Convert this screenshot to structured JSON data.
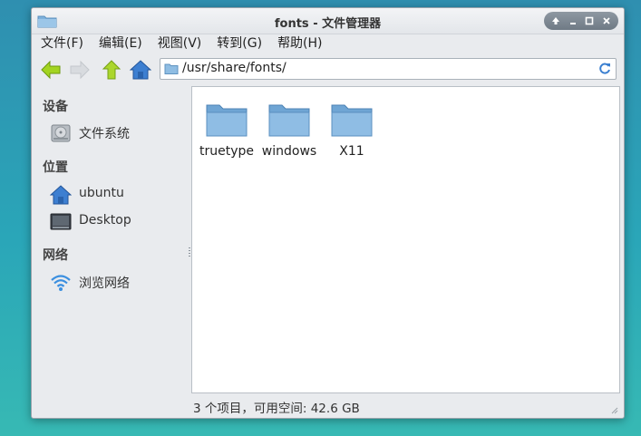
{
  "window": {
    "title": "fonts - 文件管理器"
  },
  "menu": [
    "文件(F)",
    "编辑(E)",
    "视图(V)",
    "转到(G)",
    "帮助(H)"
  ],
  "location": {
    "path": "/usr/share/fonts/"
  },
  "sidebar": {
    "sections": [
      {
        "header": "设备",
        "items": [
          {
            "label": "文件系统",
            "icon": "harddisk-icon"
          }
        ]
      },
      {
        "header": "位置",
        "items": [
          {
            "label": "ubuntu",
            "icon": "home-icon"
          },
          {
            "label": "Desktop",
            "icon": "desktop-icon"
          }
        ]
      },
      {
        "header": "网络",
        "items": [
          {
            "label": "浏览网络",
            "icon": "network-icon"
          }
        ]
      }
    ]
  },
  "files": [
    {
      "name": "truetype",
      "icon": "folder-icon"
    },
    {
      "name": "windows",
      "icon": "folder-icon"
    },
    {
      "name": "X11",
      "icon": "folder-icon"
    }
  ],
  "status": {
    "text": "3 个项目，可用空间: 42.6 GB"
  },
  "colors": {
    "desktop_top": "#2f8fb0",
    "desktop_bottom": "#37b9b4",
    "folder": "#7fb2dc",
    "back_arrow": "#9ccf1a",
    "up_arrow": "#a6d22a",
    "home": "#3d7fd1"
  }
}
